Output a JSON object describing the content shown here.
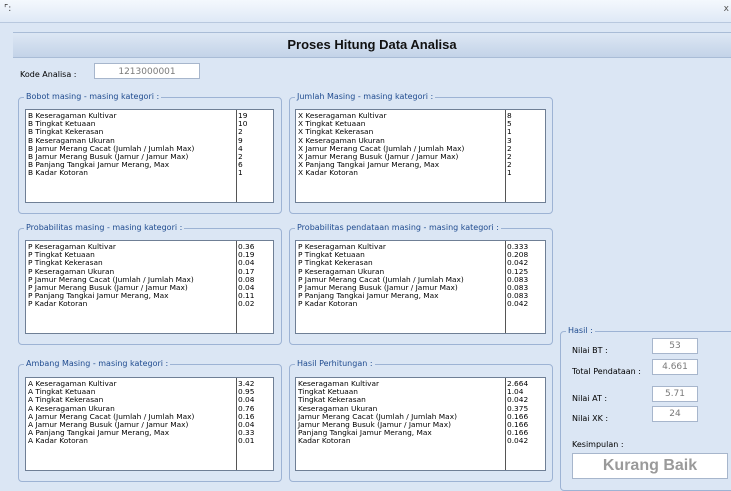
{
  "window": {
    "close_glyph": "x"
  },
  "header": {
    "title": "Proses Hitung Data Analisa"
  },
  "kode": {
    "label": "Kode Analisa :",
    "value": "1213000001"
  },
  "bobot": {
    "legend": "Bobot masing - masing kategori :",
    "rows": [
      {
        "label": "B Keseragaman Kultivar",
        "value": "19"
      },
      {
        "label": "B Tingkat Ketuaan",
        "value": "10"
      },
      {
        "label": "B Tingkat Kekerasan",
        "value": "2"
      },
      {
        "label": "B Keseragaman Ukuran",
        "value": "9"
      },
      {
        "label": "B Jamur Merang Cacat (Jumlah / Jumlah Max)",
        "value": "4"
      },
      {
        "label": "B Jamur Merang Busuk (Jamur / Jamur Max)",
        "value": "2"
      },
      {
        "label": "B Panjang Tangkai Jamur Merang, Max",
        "value": "6"
      },
      {
        "label": "B Kadar Kotoran",
        "value": "1"
      }
    ]
  },
  "jumlah": {
    "legend": "Jumlah Masing - masing kategori :",
    "rows": [
      {
        "label": "X Keseragaman Kultivar",
        "value": "8"
      },
      {
        "label": "X Tingkat Ketuaan",
        "value": "5"
      },
      {
        "label": "X Tingkat Kekerasan",
        "value": "1"
      },
      {
        "label": "X Keseragaman Ukuran",
        "value": "3"
      },
      {
        "label": "X Jamur Merang Cacat (Jumlah / Jumlah Max)",
        "value": "2"
      },
      {
        "label": "X Jamur Merang Busuk (Jamur / Jamur Max)",
        "value": "2"
      },
      {
        "label": "X Panjang Tangkai Jamur Merang, Max",
        "value": "2"
      },
      {
        "label": "X Kadar Kotoran",
        "value": "1"
      }
    ]
  },
  "prob": {
    "legend": "Probabilitas masing - masing kategori :",
    "rows": [
      {
        "label": "P Keseragaman Kultivar",
        "value": "0.36"
      },
      {
        "label": "P Tingkat Ketuaan",
        "value": "0.19"
      },
      {
        "label": "P Tingkat Kekerasan",
        "value": "0.04"
      },
      {
        "label": "P Keseragaman Ukuran",
        "value": "0.17"
      },
      {
        "label": "P Jamur Merang Cacat (Jumlah / Jumlah Max)",
        "value": "0.08"
      },
      {
        "label": "P Jamur Merang Busuk (Jamur / Jamur Max)",
        "value": "0.04"
      },
      {
        "label": "P Panjang Tangkai Jamur Merang, Max",
        "value": "0.11"
      },
      {
        "label": "P Kadar Kotoran",
        "value": "0.02"
      }
    ]
  },
  "probpend": {
    "legend": "Probabilitas pendataan masing - masing kategori :",
    "rows": [
      {
        "label": "P Keseragaman Kultivar",
        "value": "0.333"
      },
      {
        "label": "P Tingkat Ketuaan",
        "value": "0.208"
      },
      {
        "label": "P Tingkat Kekerasan",
        "value": "0.042"
      },
      {
        "label": "P Keseragaman Ukuran",
        "value": "0.125"
      },
      {
        "label": "P Jamur Merang Cacat (Jumlah / Jumlah Max)",
        "value": "0.083"
      },
      {
        "label": "P Jamur Merang Busuk (Jamur / Jamur Max)",
        "value": "0.083"
      },
      {
        "label": "P Panjang Tangkai Jamur Merang, Max",
        "value": "0.083"
      },
      {
        "label": "P Kadar Kotoran",
        "value": "0.042"
      }
    ]
  },
  "ambang": {
    "legend": "Ambang Masing - masing kategori :",
    "rows": [
      {
        "label": "A Keseragaman Kultivar",
        "value": "3.42"
      },
      {
        "label": "A Tingkat Ketuaan",
        "value": "0.95"
      },
      {
        "label": "A Tingkat Kekerasan",
        "value": "0.04"
      },
      {
        "label": "A Keseragaman Ukuran",
        "value": "0.76"
      },
      {
        "label": "A Jamur Merang Cacat (Jumlah / Jumlah Max)",
        "value": "0.16"
      },
      {
        "label": "A Jamur Merang Busuk (Jamur / Jamur Max)",
        "value": "0.04"
      },
      {
        "label": "A Panjang Tangkai Jamur Merang, Max",
        "value": "0.33"
      },
      {
        "label": "A Kadar Kotoran",
        "value": "0.01"
      }
    ]
  },
  "perhitungan": {
    "legend": "Hasil Perhitungan :",
    "rows": [
      {
        "label": "Keseragaman Kultivar",
        "value": "2.664"
      },
      {
        "label": "Tingkat Ketuaan",
        "value": "1.04"
      },
      {
        "label": "Tingkat Kekerasan",
        "value": "0.042"
      },
      {
        "label": "Keseragaman Ukuran",
        "value": "0.375"
      },
      {
        "label": "Jamur Merang Cacat (Jumlah / Jumlah Max)",
        "value": "0.166"
      },
      {
        "label": "Jamur Merang Busuk (Jamur / Jamur Max)",
        "value": "0.166"
      },
      {
        "label": "Panjang Tangkai Jamur Merang, Max",
        "value": "0.166"
      },
      {
        "label": "Kadar Kotoran",
        "value": "0.042"
      }
    ]
  },
  "hasil": {
    "legend": "Hasil :",
    "nilai_bt_label": "Nilai BT :",
    "nilai_bt": "53",
    "total_label": "Total Pendataan :",
    "total": "4.661",
    "nilai_at_label": "Nilai AT :",
    "nilai_at": "5.71",
    "nilai_xk_label": "Nilai XK :",
    "nilai_xk": "24",
    "kesimpulan_label": "Kesimpulan :",
    "kesimpulan": "Kurang Baik"
  }
}
